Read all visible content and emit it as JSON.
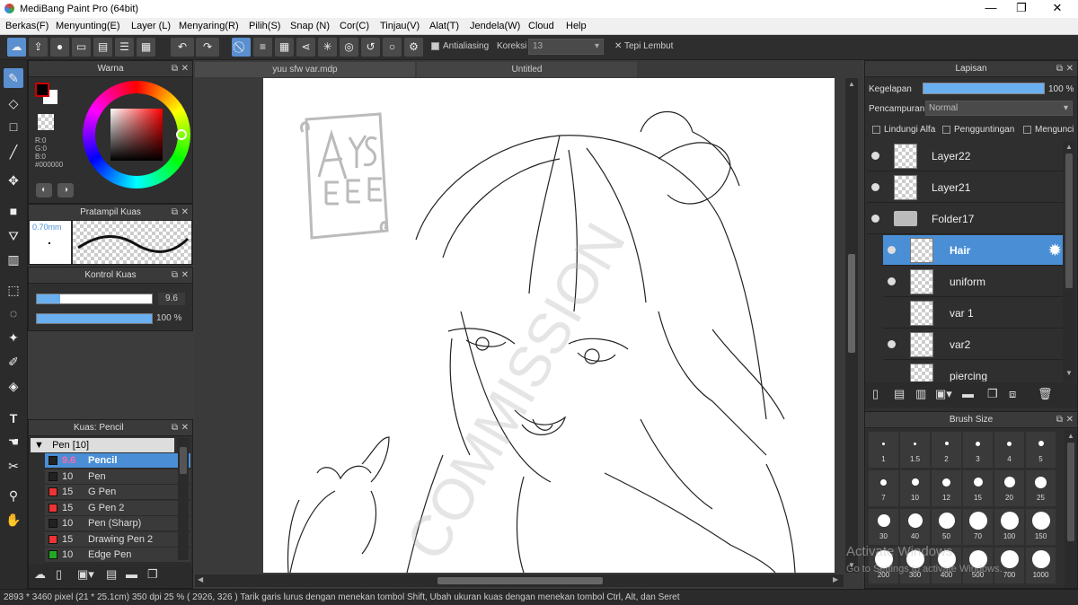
{
  "window": {
    "title": "MediBang Paint Pro (64bit)",
    "minimize": "—",
    "maximize": "❐",
    "close": "✕"
  },
  "menu": [
    "Berkas(F)",
    "Menyunting(E)",
    "Layer (L)",
    "Menyaring(R)",
    "Pilih(S)",
    "Snap (N)",
    "Cor(C)",
    "Tinjau(V)",
    "Alat(T)",
    "Jendela(W)",
    "Cloud",
    "Help"
  ],
  "toolbar": {
    "antialias_label": "Antialiasing",
    "correction_label": "Koreksi",
    "correction_value": "13",
    "smooth_label": "Tepi Lembut"
  },
  "color_panel": {
    "title": "Warna",
    "r": "R:0",
    "g": "G:0",
    "b": "B:0",
    "hex": "#000000",
    "fg_color": "#000000",
    "bg_color": "#ffffff",
    "accent": "#cc0000"
  },
  "brush_preview": {
    "title": "Pratampil Kuas",
    "size": "0.70mm"
  },
  "brush_control": {
    "title": "Kontrol Kuas",
    "size_value": "9.6",
    "opacity_value": "100 %",
    "size_fraction": 0.2,
    "opacity_fraction": 1.0
  },
  "brush_list": {
    "title": "Kuas: Pencil",
    "group": "Pen [10]",
    "items": [
      {
        "size": "9.6",
        "name": "Pencil",
        "color": "#222222",
        "selected": true
      },
      {
        "size": "10",
        "name": "Pen",
        "color": "#222222"
      },
      {
        "size": "15",
        "name": "G Pen",
        "color": "#ee3333"
      },
      {
        "size": "15",
        "name": "G Pen 2",
        "color": "#ee3333"
      },
      {
        "size": "10",
        "name": "Pen (Sharp)",
        "color": "#222222"
      },
      {
        "size": "15",
        "name": "Drawing Pen 2",
        "color": "#ee3333"
      },
      {
        "size": "10",
        "name": "Edge Pen",
        "color": "#22aa22"
      }
    ]
  },
  "tabs": [
    "yuu sfw var.mdp",
    "Untitled"
  ],
  "canvas": {
    "watermark_text": "COMMISSION"
  },
  "layers": {
    "title": "Lapisan",
    "opacity_label": "Kegelapan",
    "opacity_value": "100 %",
    "blend_label": "Pencampuran",
    "blend_value": "Normal",
    "protect_alpha": "Lindungi Alfa",
    "clipping": "Pengguntingan",
    "lock": "Mengunci",
    "items": [
      {
        "name": "Layer22",
        "visible": true,
        "indent": false
      },
      {
        "name": "Layer21",
        "visible": true,
        "indent": false
      },
      {
        "name": "Folder17",
        "visible": true,
        "indent": false,
        "folder": true
      },
      {
        "name": "Hair",
        "visible": true,
        "indent": true,
        "active": true
      },
      {
        "name": "uniform",
        "visible": true,
        "indent": true
      },
      {
        "name": "var 1",
        "visible": false,
        "indent": true
      },
      {
        "name": "var2",
        "visible": true,
        "indent": true
      },
      {
        "name": "piercing",
        "visible": false,
        "indent": true
      }
    ]
  },
  "brush_size": {
    "title": "Brush Size",
    "sizes": [
      "1",
      "1.5",
      "2",
      "3",
      "4",
      "5",
      "7",
      "10",
      "12",
      "15",
      "20",
      "25",
      "30",
      "40",
      "50",
      "70",
      "100",
      "150",
      "200",
      "300",
      "400",
      "500",
      "700",
      "1000"
    ]
  },
  "status": "2893 * 3460 pixel   (21 * 25.1cm)   350 dpi   25 %   ( 2926, 326 )   Tarik garis lurus dengan menekan tombol Shift, Ubah ukuran kuas dengan menekan tombol Ctrl, Alt, dan Seret",
  "os_overlay": {
    "line1": "Activate Windows",
    "line2": "Go to Settings to activate Windows."
  }
}
